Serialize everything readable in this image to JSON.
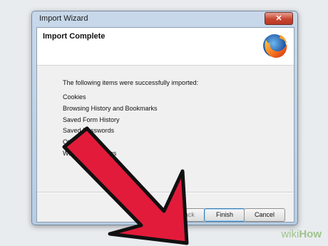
{
  "window": {
    "title": "Import Wizard",
    "close_label": "✕"
  },
  "header": {
    "title": "Import Complete",
    "logo_icon": "firefox-logo"
  },
  "body": {
    "intro": "The following items were successfully imported:",
    "items": [
      "Cookies",
      "Browsing History and Bookmarks",
      "Saved Form History",
      "Saved Passwords",
      "Other Data",
      "Windows and Tabs"
    ]
  },
  "buttons": {
    "back": "< Back",
    "finish": "Finish",
    "cancel": "Cancel"
  },
  "overlay": {
    "arrow_color": "#e31b3a",
    "watermark_prefix": "wiki",
    "watermark_suffix": "How"
  }
}
